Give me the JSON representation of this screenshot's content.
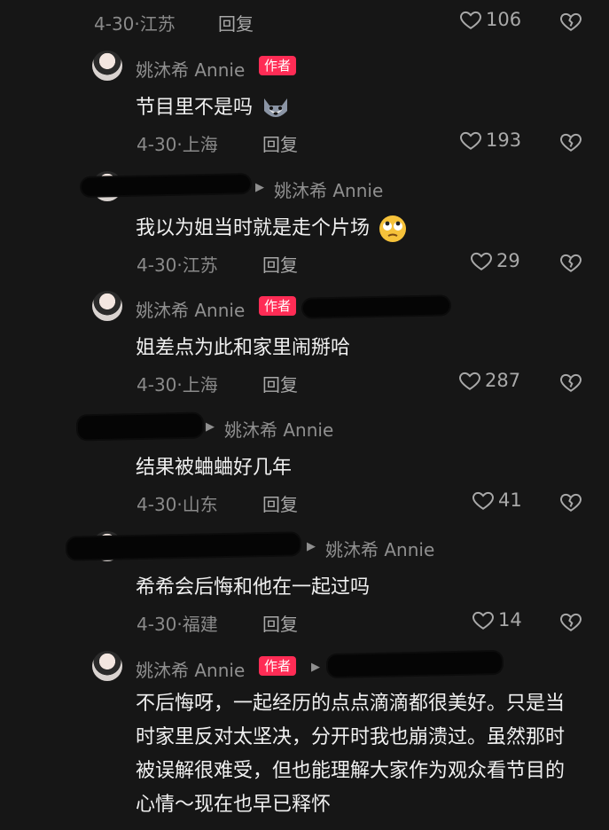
{
  "comments": [
    {
      "date": "4-30",
      "location": "江苏",
      "reply": "回复",
      "likes": "106"
    },
    {
      "user": "姚沐希 Annie",
      "badge": "作者",
      "text": "节目里不是吗",
      "emoji": "husky-emoji-icon",
      "date": "4-30",
      "location": "上海",
      "reply": "回复",
      "likes": "193"
    },
    {
      "reply_to": "姚沐希 Annie",
      "text": "我以为姐当时就是走个片场",
      "emoji": "rolling-eyes-emoji-icon",
      "date": "4-30",
      "location": "江苏",
      "reply": "回复",
      "likes": "29"
    },
    {
      "user": "姚沐希 Annie",
      "badge": "作者",
      "text": "姐差点为此和家里闹掰哈",
      "date": "4-30",
      "location": "上海",
      "reply": "回复",
      "likes": "287"
    },
    {
      "reply_to": "姚沐希 Annie",
      "text": "结果被蛐蛐好几年",
      "date": "4-30",
      "location": "山东",
      "reply": "回复",
      "likes": "41"
    },
    {
      "reply_to": "姚沐希 Annie",
      "text": "希希会后悔和他在一起过吗",
      "date": "4-30",
      "location": "福建",
      "reply": "回复",
      "likes": "14"
    },
    {
      "user": "姚沐希 Annie",
      "badge": "作者",
      "text": "不后悔呀，一起经历的点点滴滴都很美好。只是当时家里反对太坚决，分开时我也崩溃过。虽然那时被误解很难受，但也能理解大家作为观众看节目的心情～现在也早已释怀"
    }
  ],
  "colors": {
    "background": "#161616",
    "author_badge": "#ff2c55",
    "meta_text": "#8a8a8a"
  }
}
